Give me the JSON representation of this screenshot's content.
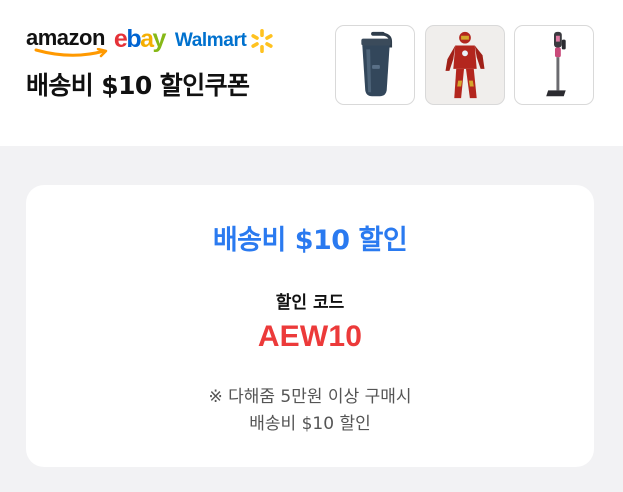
{
  "banner": {
    "logos": {
      "amazon": "amazon",
      "ebay": [
        "e",
        "b",
        "a",
        "y"
      ],
      "walmart": "Walmart"
    },
    "headline": "배송비 $10 할인쿠폰",
    "products": [
      {
        "icon": "tumbler-product-image"
      },
      {
        "icon": "iron-man-figure-product-image"
      },
      {
        "icon": "stick-vacuum-product-image"
      }
    ]
  },
  "coupon": {
    "title": "배송비 $10 할인",
    "code_label": "할인 코드",
    "code": "AEW10",
    "note_line1": "※ 다해줌 5만원 이상 구매시",
    "note_line2": "배송비 $10 할인"
  },
  "colors": {
    "accent_blue": "#2a7af0",
    "code_red": "#ec3a3a",
    "amazon_orange": "#ff9900",
    "ebay": [
      "#e53238",
      "#0064d2",
      "#f5af02",
      "#86b817"
    ],
    "walmart_blue": "#0071ce",
    "walmart_yellow": "#ffc220"
  }
}
